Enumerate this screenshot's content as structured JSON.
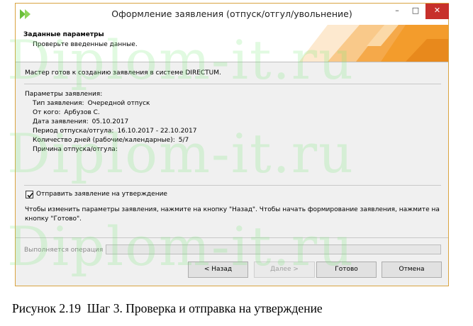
{
  "window": {
    "title": "Оформление заявления (отпуск/отгул/увольнение)",
    "controls": {
      "minimize": "–",
      "maximize": "□",
      "close": "✕"
    }
  },
  "header": {
    "title": "Заданные параметры",
    "subtitle": "Проверьте введенные данные."
  },
  "intro": "Мастер готов к созданию заявления в системе DIRECTUM.",
  "params": {
    "heading": "Параметры заявления:",
    "rows": [
      {
        "label": "Тип заявления:",
        "value": "Очередной отпуск"
      },
      {
        "label": "От кого:",
        "value": "Арбузов С."
      },
      {
        "label": "Дата заявления:",
        "value": "05.10.2017"
      },
      {
        "label": "Период отпуска/отгула:",
        "value": "16.10.2017 - 22.10.2017"
      },
      {
        "label": "Количество дней (рабочие/календарные):",
        "value": "5/7"
      },
      {
        "label": "Причина отпуска/отгула:",
        "value": ""
      }
    ]
  },
  "send_checkbox": {
    "label": "Отправить заявление на утверждение",
    "checked": true
  },
  "hint": "Чтобы изменить параметры заявления, нажмите на кнопку \"Назад\". Чтобы начать формирование заявления, нажмите на кнопку \"Готово\".",
  "progress": {
    "label": "Выполняется операция",
    "fraction": 0
  },
  "buttons": {
    "back": "< Назад",
    "next": "Далее >",
    "done": "Готово",
    "cancel": "Отмена"
  },
  "watermark": "Diplom-it.ru",
  "caption": "Рисунок 2.19  Шаг 3. Проверка и отправка на утверждение",
  "colors": {
    "accent_orange": "#f39c2c",
    "close_red": "#c7302b",
    "app_icon_green": "#6bbf3a",
    "watermark_green": "#78e678"
  }
}
